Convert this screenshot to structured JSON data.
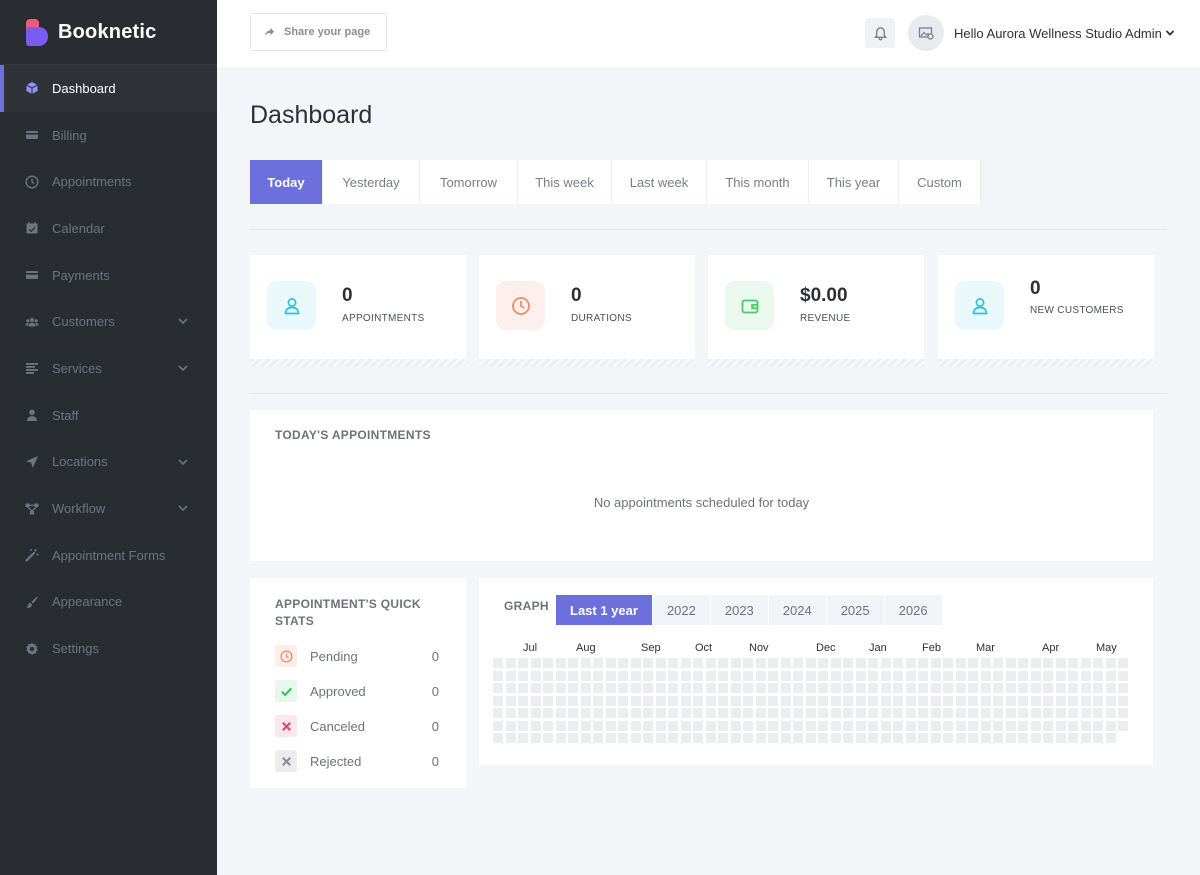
{
  "brand": {
    "name": "Booknetic"
  },
  "sidebar": {
    "items": [
      {
        "label": "Dashboard",
        "icon": "cube-icon",
        "active": true,
        "has_submenu": false
      },
      {
        "label": "Billing",
        "icon": "card-icon",
        "active": false,
        "has_submenu": false
      },
      {
        "label": "Appointments",
        "icon": "clock-icon",
        "active": false,
        "has_submenu": false
      },
      {
        "label": "Calendar",
        "icon": "calendar-icon",
        "active": false,
        "has_submenu": false
      },
      {
        "label": "Payments",
        "icon": "credit-card-icon",
        "active": false,
        "has_submenu": false
      },
      {
        "label": "Customers",
        "icon": "users-icon",
        "active": false,
        "has_submenu": true
      },
      {
        "label": "Services",
        "icon": "list-icon",
        "active": false,
        "has_submenu": true
      },
      {
        "label": "Staff",
        "icon": "user-icon",
        "active": false,
        "has_submenu": false
      },
      {
        "label": "Locations",
        "icon": "location-arrow-icon",
        "active": false,
        "has_submenu": true
      },
      {
        "label": "Workflow",
        "icon": "flow-icon",
        "active": false,
        "has_submenu": true
      },
      {
        "label": "Appointment Forms",
        "icon": "magic-wand-icon",
        "active": false,
        "has_submenu": false
      },
      {
        "label": "Appearance",
        "icon": "brush-icon",
        "active": false,
        "has_submenu": false
      },
      {
        "label": "Settings",
        "icon": "gear-icon",
        "active": false,
        "has_submenu": false
      }
    ]
  },
  "topbar": {
    "share_label": "Share your page",
    "user_greeting": "Hello Aurora Wellness Studio Admin"
  },
  "page": {
    "title": "Dashboard"
  },
  "ranges": [
    {
      "label": "Today",
      "active": true
    },
    {
      "label": "Yesterday",
      "active": false
    },
    {
      "label": "Tomorrow",
      "active": false
    },
    {
      "label": "This week",
      "active": false
    },
    {
      "label": "Last week",
      "active": false
    },
    {
      "label": "This month",
      "active": false
    },
    {
      "label": "This year",
      "active": false
    },
    {
      "label": "Custom",
      "active": false
    }
  ],
  "stats": [
    {
      "value": "0",
      "label": "APPOINTMENTS",
      "icon": "user-icon",
      "color": "#2ec4d6",
      "bg": "#e9f8fa"
    },
    {
      "value": "0",
      "label": "DURATIONS",
      "icon": "clock-icon",
      "color": "#f08a6a",
      "bg": "#fdf0ec"
    },
    {
      "value": "$0.00",
      "label": "REVENUE",
      "icon": "wallet-icon",
      "color": "#4cc96a",
      "bg": "#ebf8ee"
    },
    {
      "value": "0",
      "label": "NEW CUSTOMERS",
      "icon": "user-icon",
      "color": "#2ec4d6",
      "bg": "#e9f8fa"
    }
  ],
  "today_appointments": {
    "title": "TODAY'S APPOINTMENTS",
    "empty_text": "No appointments scheduled for today"
  },
  "quick_stats": {
    "title": "APPOINTMENT'S QUICK STATS",
    "items": [
      {
        "label": "Pending",
        "count": "0",
        "icon": "clock-icon",
        "color": "#f08a6a",
        "bg": "#fdeee9"
      },
      {
        "label": "Approved",
        "count": "0",
        "icon": "check-icon",
        "color": "#3cc25c",
        "bg": "#e8f7ec"
      },
      {
        "label": "Canceled",
        "count": "0",
        "icon": "x-icon",
        "color": "#e8476a",
        "bg": "#fde7ec"
      },
      {
        "label": "Rejected",
        "count": "0",
        "icon": "x-icon",
        "color": "#8a8d94",
        "bg": "#ececef"
      }
    ]
  },
  "graph": {
    "title": "GRAPH",
    "years": [
      {
        "label": "Last 1 year",
        "active": true
      },
      {
        "label": "2022",
        "active": false
      },
      {
        "label": "2023",
        "active": false
      },
      {
        "label": "2024",
        "active": false
      },
      {
        "label": "2025",
        "active": false
      },
      {
        "label": "2026",
        "active": false
      }
    ],
    "months": [
      "Jul",
      "Aug",
      "Sep",
      "Oct",
      "Nov",
      "Dec",
      "Jan",
      "Feb",
      "Mar",
      "Apr",
      "May"
    ],
    "weeks": 51,
    "last_week_days": 6,
    "cell_color": "#ebedf0"
  },
  "colors": {
    "accent": "#6c70dc",
    "sidebar_bg": "#292d32",
    "page_bg": "#f4f5f9"
  }
}
